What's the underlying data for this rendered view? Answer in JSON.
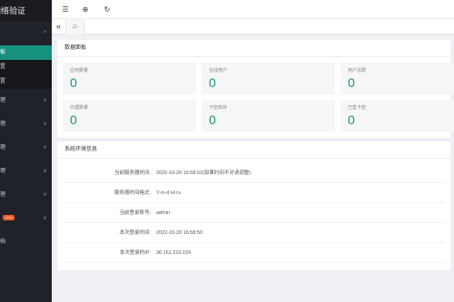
{
  "sidebar": {
    "logo_text": "网络验证",
    "items": [
      {
        "label": "",
        "chevron": "^"
      },
      {
        "label": "板",
        "active": true
      },
      {
        "label": "置"
      },
      {
        "label": "置"
      },
      {
        "label": "理",
        "chevron": "v"
      },
      {
        "label": "理",
        "chevron": "v"
      },
      {
        "label": "理",
        "chevron": "v"
      },
      {
        "label": "理",
        "chevron": "v"
      },
      {
        "label": "理",
        "chevron": "v"
      },
      {
        "label": "",
        "badge": "new",
        "chevron": "v"
      },
      {
        "label": "档"
      }
    ]
  },
  "topbar": {
    "menu_icon": "☰",
    "globe_icon": "⊕",
    "refresh_icon": "↻"
  },
  "tabs": {
    "scroll_left_icon": "«",
    "home_icon": "⌂"
  },
  "dashboard": {
    "title": "数据面板",
    "stats": [
      {
        "label": "应用数量",
        "value": "0"
      },
      {
        "label": "在线用户",
        "value": "0"
      },
      {
        "label": "用户总数",
        "value": "0"
      },
      {
        "label": "代理数量",
        "value": "0"
      },
      {
        "label": "卡密库存",
        "value": "0"
      },
      {
        "label": "已售卡密",
        "value": "0"
      }
    ]
  },
  "environment": {
    "title": "系统环境信息",
    "rows": [
      {
        "key": "当前服务器时间:",
        "value": "2022-10-20 16:58:52(如果时间不对请调整)"
      },
      {
        "key": "服务器时间格式:",
        "value": "Y-m-d H:i:s"
      },
      {
        "key": "当前登录账号:",
        "value": "admin"
      },
      {
        "key": "本次登录时间:",
        "value": "2022-10-20 16:58:50"
      },
      {
        "key": "本次登录的IP:",
        "value": "36.161.210.159"
      }
    ]
  },
  "colors": {
    "accent": "#16907f",
    "sidebar_bg": "#20222a",
    "badge": "#ff5722"
  }
}
